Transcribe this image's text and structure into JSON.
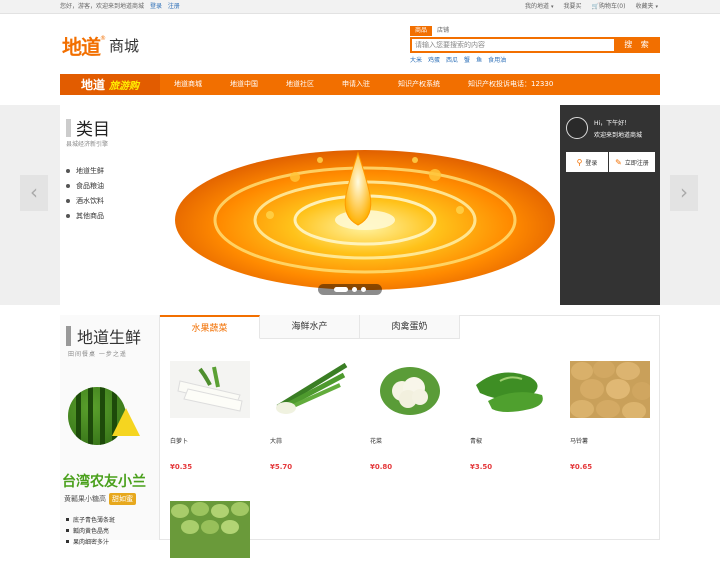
{
  "topbar": {
    "welcome": "您好，游客，欢迎来到地道商城",
    "login": "登录",
    "register": "注册",
    "my_didao": "我的地道",
    "i_want_buy": "我要买",
    "cart": "购物车(0)",
    "favorites": "收藏夹"
  },
  "header": {
    "logo_mark": "地道",
    "logo_reg": "®",
    "logo_text": "商城",
    "search_tabs": [
      "商品",
      "店铺"
    ],
    "search_placeholder": "请输入您要搜索的内容",
    "search_button": "搜 索",
    "hot_words": [
      "大米",
      "鸡蛋",
      "西瓜",
      "蟹",
      "鱼",
      "食用油"
    ]
  },
  "nav": {
    "brand_a": "地道",
    "brand_b": "旅游购",
    "items": [
      "地道商城",
      "地道中国",
      "地道社区",
      "申请入驻",
      "知识产权系统",
      "知识产权投诉电话：12330"
    ]
  },
  "categories": {
    "title": "类目",
    "subtitle": "县城经济新引擎",
    "items": [
      "地道生鲜",
      "食品粮油",
      "酒水饮料",
      "其他商品"
    ]
  },
  "slider": {
    "prev_glyph": "‹",
    "next_glyph": "›",
    "dots": 3,
    "active_dot": 0
  },
  "user_panel": {
    "greeting": "Hi，下午好！",
    "welcome": "欢迎来到地道商城",
    "login_label": "登录",
    "register_label": "立即注册"
  },
  "section": {
    "title": "地道生鲜",
    "subtitle": "田间餐桌 一步之遥",
    "promo_title": "台湾农友小兰",
    "promo_line": "黄瓤果小糖高",
    "promo_tag": "甜如蜜",
    "promo_features": [
      "底子青色薄条斑",
      "瓤肉黄色晶亮",
      "果肉细密多汁"
    ],
    "tabs": [
      "水果蔬菜",
      "海鲜水产",
      "肉禽蛋奶"
    ],
    "active_tab": 0
  },
  "products": [
    {
      "name": "白萝卜",
      "price": "¥0.35"
    },
    {
      "name": "大蒜",
      "price": "¥5.70"
    },
    {
      "name": "花菜",
      "price": "¥0.80"
    },
    {
      "name": "青椒",
      "price": "¥3.50"
    },
    {
      "name": "马铃薯",
      "price": "¥0.65"
    },
    {
      "name": "",
      "price": ""
    }
  ],
  "colors": {
    "brand_orange": "#f26f00",
    "price_red": "#e4393c",
    "link_blue": "#2c6fb8",
    "user_panel_bg": "#333333"
  }
}
